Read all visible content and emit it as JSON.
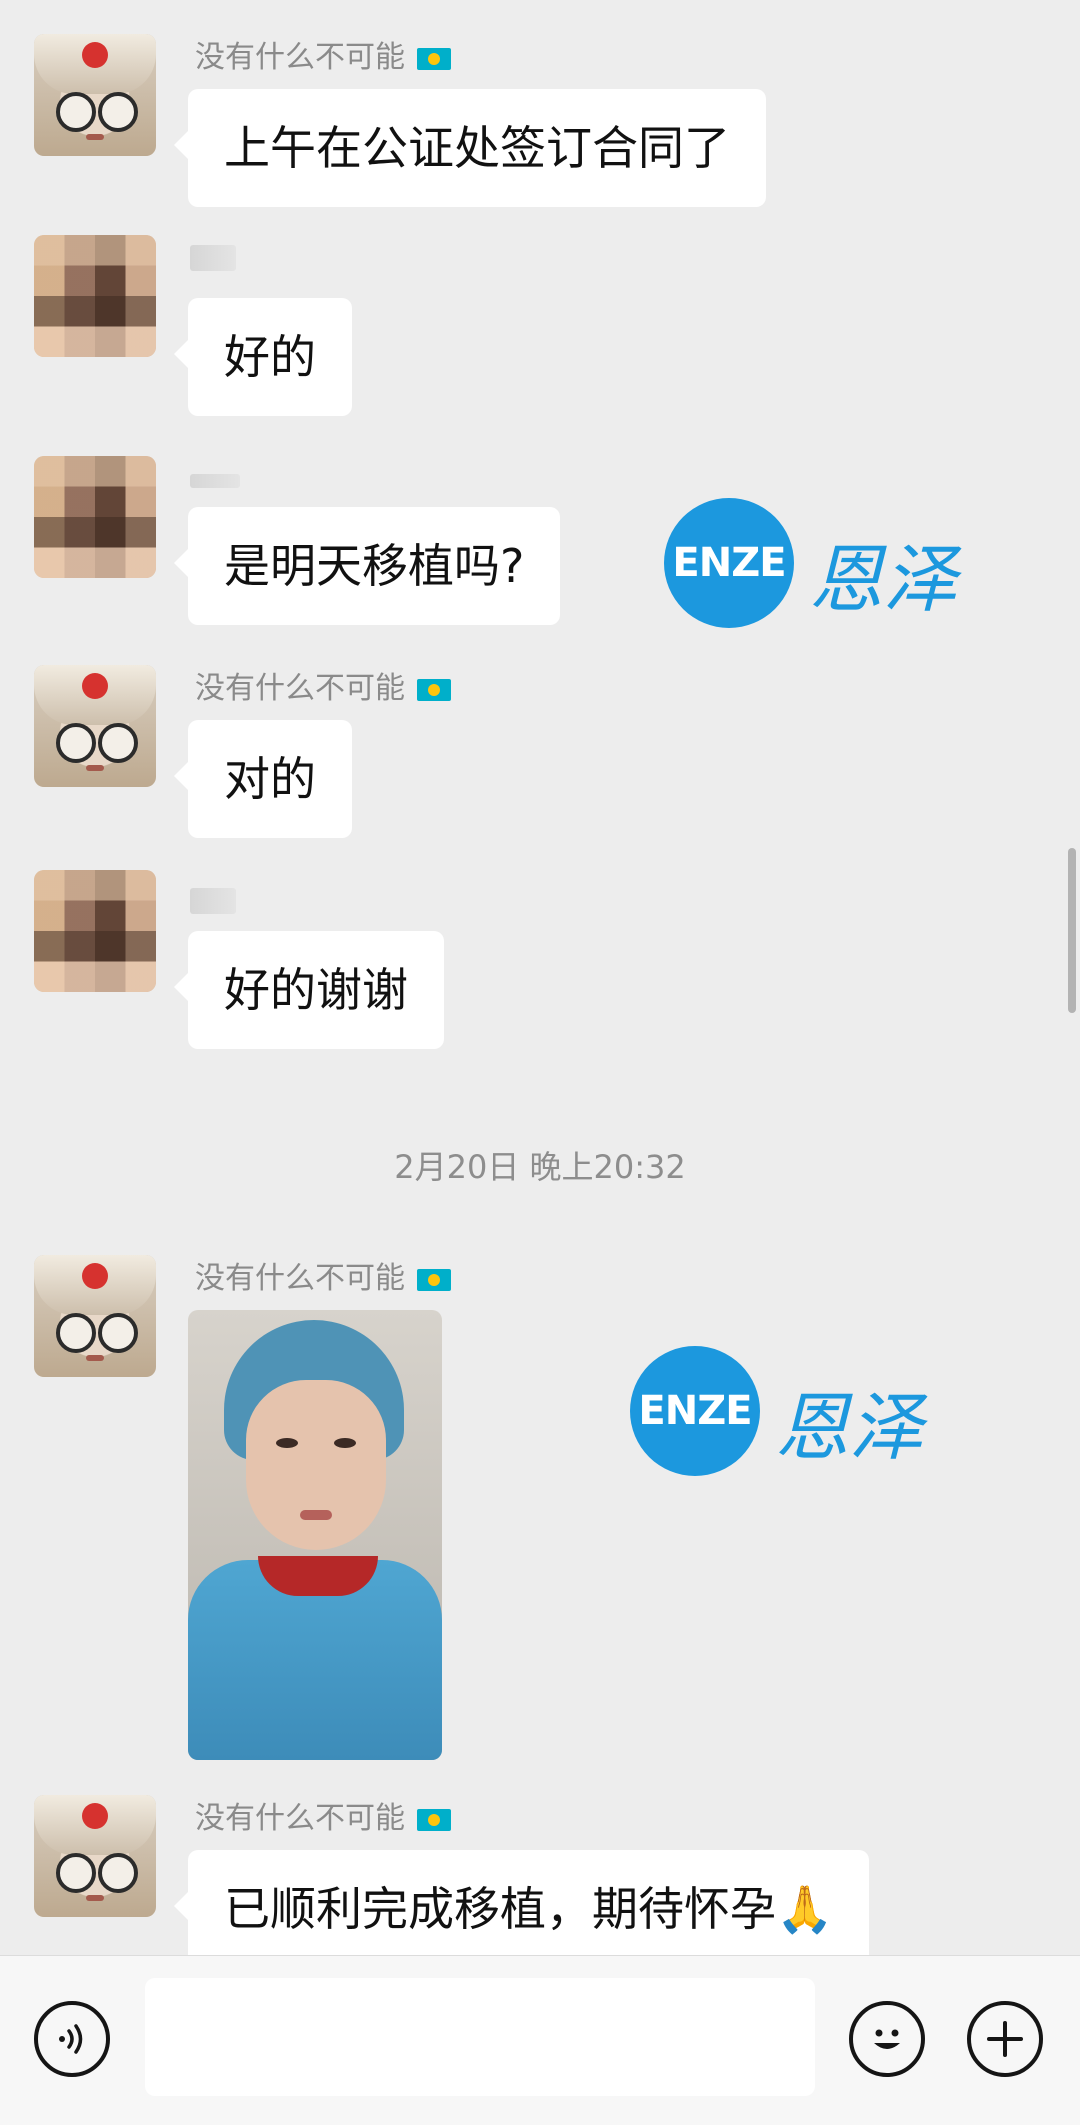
{
  "messages": [
    {
      "sender": "没有什么不可能",
      "avatar": "cartoon-girl-avatar",
      "text": "上午在公证处签订合同了"
    },
    {
      "sender": "",
      "avatar": "blurred-avatar",
      "text": "好的"
    },
    {
      "sender": "",
      "avatar": "blurred-avatar",
      "text": "是明天移植吗?"
    },
    {
      "sender": "没有什么不可能",
      "avatar": "cartoon-girl-avatar",
      "text": "对的"
    },
    {
      "sender": "",
      "avatar": "blurred-avatar",
      "text": "好的谢谢"
    },
    {
      "sender": "没有什么不可能",
      "avatar": "cartoon-girl-avatar",
      "text": "",
      "photo": "patient-in-surgical-gown-photo"
    },
    {
      "sender": "没有什么不可能",
      "avatar": "cartoon-girl-avatar",
      "text": "已顺利完成移植，期待怀孕🙏"
    }
  ],
  "timestamp": "2月20日 晚上20:32",
  "watermark": {
    "latin": "ENZE",
    "chinese": "恩泽",
    "color": "#1c98de"
  },
  "sender_flag": "kazakhstan-flag-icon",
  "input_bar": {
    "voice_icon": "voice-icon",
    "emoji_icon": "emoji-icon",
    "plus_icon": "plus-icon",
    "value": ""
  },
  "colors": {
    "background": "#ededed",
    "bubble": "#ffffff",
    "accent": "#1c98de"
  }
}
